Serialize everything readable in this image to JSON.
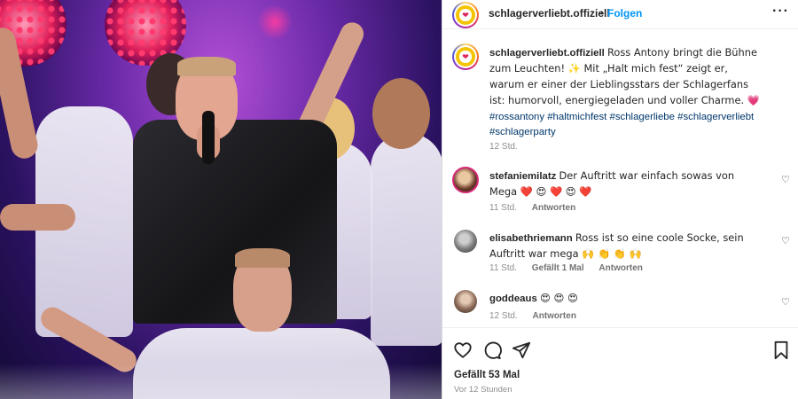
{
  "post": {
    "username": "schlagerverliebt.offiziell",
    "separator": "•",
    "follow_label": "Folgen",
    "more_icon": "more-horizontal-icon",
    "caption_user": "schlagerverliebt.offiziell",
    "caption_text": "Ross Antony bringt die Bühne zum Leuchten! ✨ Mit „Halt mich fest“ zeigt er, warum er einer der Lieblingsstars der Schlagerfans ist: humorvoll, energiegeladen und voller Charme. 💗",
    "hashtags": "#rossantony #haltmichfest #schlagerliebe #schlagerverliebt #schlagerparty",
    "caption_time": "12 Std."
  },
  "comments": [
    {
      "user": "stefaniemilatz",
      "text": "Der Auftritt war einfach sowas von Mega ❤️ 😍 ❤️ 😍 ❤️",
      "time": "11 Std.",
      "likes": "",
      "reply": "Antworten"
    },
    {
      "user": "elisabethriemann",
      "text": "Ross ist so eine coole Socke, sein Auftritt war mega 🙌 👏 👏 🙌",
      "time": "11 Std.",
      "likes": "Gefällt 1 Mal",
      "reply": "Antworten"
    },
    {
      "user": "goddeaus",
      "text": "😍 😍 😍",
      "time": "12 Std.",
      "likes": "",
      "reply": "Antworten"
    }
  ],
  "actions": {
    "like_icon": "heart-outline-icon",
    "comment_icon": "comment-icon",
    "share_icon": "send-icon",
    "save_icon": "bookmark-icon",
    "likes_count": "Gefällt 53 Mal",
    "posted_ago": "Vor 12 Stunden"
  },
  "colors": {
    "link": "#00376b",
    "follow": "#0095f6",
    "muted": "#8e8e8e",
    "text": "#262626"
  }
}
